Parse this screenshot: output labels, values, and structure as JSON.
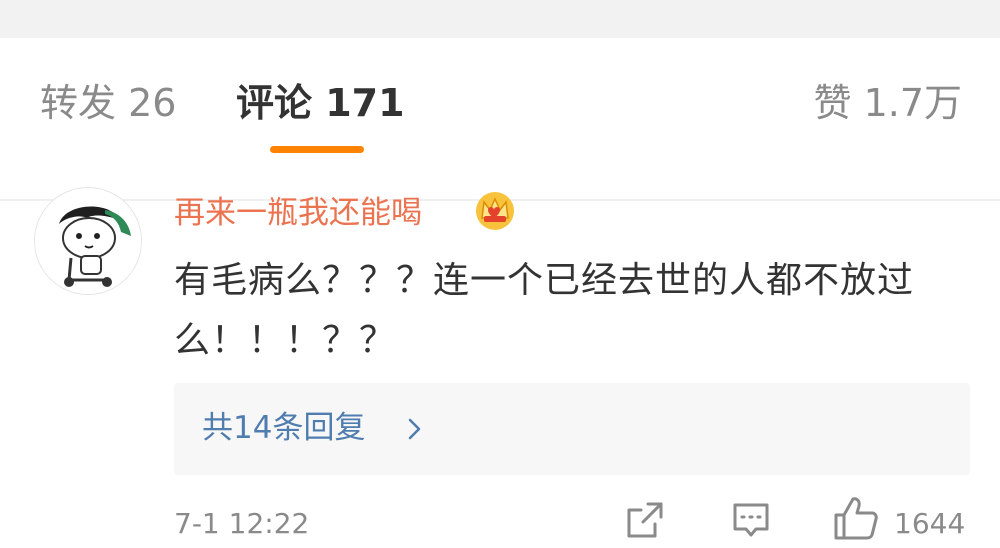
{
  "tabs": {
    "reposts": "转发 26",
    "comments": "评论 171",
    "likes": "赞 1.7万"
  },
  "comment": {
    "username": "再来一瓶我还能喝",
    "text": "有毛病么？？？连一个已经去世的人都不放过么！！！？？",
    "replies_label": "共14条回复",
    "time": "7-1 12:22",
    "like_count": "1644"
  },
  "colors": {
    "accent": "#ff8200",
    "username": "#eb7350",
    "link": "#507daf",
    "muted": "#8a8a8a",
    "text": "#333333"
  },
  "icons": [
    "crown-badge-icon",
    "chevron-right-icon",
    "share-icon",
    "reply-icon",
    "like-icon"
  ]
}
